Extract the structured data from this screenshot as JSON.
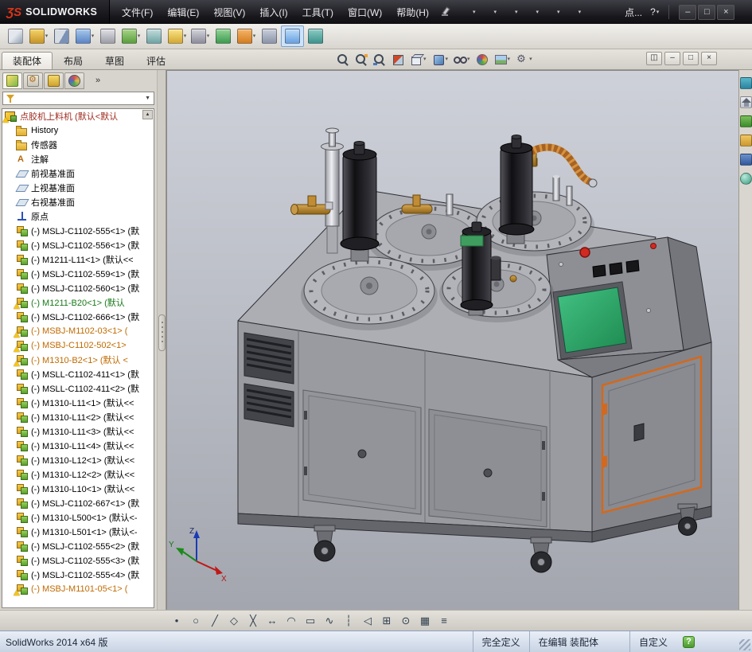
{
  "titlebar": {
    "brand_mark": "ƷS",
    "brand": "SOLIDWORKS",
    "menus": [
      {
        "label": "文件(F)"
      },
      {
        "label": "编辑(E)"
      },
      {
        "label": "视图(V)"
      },
      {
        "label": "插入(I)"
      },
      {
        "label": "工具(T)"
      },
      {
        "label": "窗口(W)"
      },
      {
        "label": "帮助(H)"
      }
    ],
    "quick_tools": [
      {
        "name": "new-document-icon",
        "cls": "q-new",
        "mods": "has-dd"
      },
      {
        "name": "open-icon",
        "cls": "q-open",
        "mods": "has-dd"
      },
      {
        "name": "save-icon",
        "cls": "q-save",
        "mods": "has-dd"
      },
      {
        "name": "print-icon",
        "cls": "q-print",
        "mods": "has-dd"
      },
      {
        "name": "undo-icon",
        "cls": "q-undo",
        "mods": "has-dd"
      },
      {
        "name": "select-icon",
        "cls": "q-select",
        "mods": "has-dd"
      },
      {
        "name": "rebuild-icon",
        "cls": "q-rebuild",
        "mods": ""
      },
      {
        "name": "options-gear-icon",
        "cls": "q-gear",
        "mods": ""
      }
    ],
    "more_label": "点...",
    "help_label": "?",
    "window_controls": [
      {
        "name": "minimize-button",
        "g": "–"
      },
      {
        "name": "maximize-button",
        "g": "□"
      },
      {
        "name": "close-button",
        "g": "×"
      }
    ]
  },
  "toolbar": {
    "buttons": [
      {
        "name": "edit-component-icon",
        "cls": "c1",
        "mods": ""
      },
      {
        "name": "insert-components-icon",
        "cls": "c2",
        "mods": "has-dd"
      },
      {
        "name": "mate-icon",
        "cls": "c3",
        "mods": ""
      },
      {
        "name": "linear-component-pattern-icon",
        "cls": "c4",
        "mods": "has-dd"
      },
      {
        "name": "smart-fasteners-icon",
        "cls": "c5",
        "mods": ""
      },
      {
        "name": "move-component-icon",
        "cls": "c6",
        "mods": "has-dd"
      },
      {
        "name": "show-hidden-components-icon",
        "cls": "c7",
        "mods": ""
      },
      {
        "name": "assembly-features-icon",
        "cls": "c8",
        "mods": "has-dd"
      },
      {
        "name": "reference-geometry-icon",
        "cls": "c9",
        "mods": "has-dd"
      },
      {
        "name": "new-motion-study-icon",
        "cls": "c10",
        "mods": ""
      },
      {
        "name": "bill-of-materials-icon",
        "cls": "c11",
        "mods": "has-dd"
      },
      {
        "name": "exploded-view-icon",
        "cls": "c12",
        "mods": ""
      },
      {
        "name": "instant3d-icon",
        "cls": "c13",
        "mods": "active"
      },
      {
        "name": "external-references-icon",
        "cls": "c14",
        "mods": ""
      }
    ]
  },
  "ribbon_tabs": [
    {
      "label": "装配体",
      "mods": "active"
    },
    {
      "label": "布局",
      "mods": ""
    },
    {
      "label": "草图",
      "mods": ""
    },
    {
      "label": "评估",
      "mods": ""
    }
  ],
  "headsup": [
    {
      "name": "zoom-fit-icon",
      "cls": "h-mag",
      "mods": ""
    },
    {
      "name": "zoom-area-icon",
      "cls": "h-mag2",
      "mods": ""
    },
    {
      "name": "previous-view-icon",
      "cls": "h-mag3",
      "mods": ""
    },
    {
      "name": "section-view-icon",
      "cls": "h-sect",
      "mods": ""
    },
    {
      "name": "view-orientation-icon",
      "cls": "h-cube",
      "mods": "has-dd"
    },
    {
      "name": "display-style-icon",
      "cls": "h-disp",
      "mods": "has-dd"
    },
    {
      "name": "hide-show-items-icon",
      "cls": "h-eye",
      "mods": "has-dd"
    },
    {
      "name": "edit-appearance-icon",
      "cls": "h-ball",
      "mods": ""
    },
    {
      "name": "apply-scene-icon",
      "cls": "h-scene",
      "mods": "has-dd"
    },
    {
      "name": "view-settings-icon",
      "cls": "h-gear",
      "mods": "has-dd"
    }
  ],
  "doc_controls": [
    {
      "name": "tile-window-button",
      "g": "◫"
    },
    {
      "name": "minimize-doc-button",
      "g": "–"
    },
    {
      "name": "restore-doc-button",
      "g": "□"
    },
    {
      "name": "close-doc-button",
      "g": "×"
    }
  ],
  "panel": {
    "tabs": [
      {
        "name": "featuremanager-tab",
        "cls": "pt-p1",
        "mods": "active"
      },
      {
        "name": "propertymanager-tab",
        "cls": "pt-p2",
        "mods": ""
      },
      {
        "name": "configurationmanager-tab",
        "cls": "pt-p3",
        "mods": ""
      },
      {
        "name": "displaymanager-tab",
        "cls": "pt-p4",
        "mods": ""
      }
    ],
    "overflow_label": "»",
    "filter_caret": "▼"
  },
  "tree": {
    "scroll_up": "▲",
    "items": [
      {
        "cls": "lvl0 c-red",
        "icon": "i-root",
        "warn": "on",
        "label": "点胶机上料机 (默认<默认"
      },
      {
        "cls": "lvl1",
        "icon": "i-fold",
        "warn": "",
        "label": "History"
      },
      {
        "cls": "lvl1",
        "icon": "i-fold",
        "warn": "",
        "label": "传感器"
      },
      {
        "cls": "lvl1",
        "icon": "i-ann",
        "warn": "",
        "label": "注解"
      },
      {
        "cls": "lvl1",
        "icon": "i-plane",
        "warn": "",
        "label": "前视基准面"
      },
      {
        "cls": "lvl1",
        "icon": "i-plane",
        "warn": "",
        "label": "上视基准面"
      },
      {
        "cls": "lvl1",
        "icon": "i-plane",
        "warn": "",
        "label": "右视基准面"
      },
      {
        "cls": "lvl1",
        "icon": "i-origin",
        "warn": "",
        "label": "原点"
      },
      {
        "cls": "lvl1",
        "icon": "i-asm",
        "warn": "",
        "label": "(-) MSLJ-C1102-555<1> (默"
      },
      {
        "cls": "lvl1",
        "icon": "i-asm",
        "warn": "",
        "label": "(-) MSLJ-C1102-556<1> (默"
      },
      {
        "cls": "lvl1",
        "icon": "i-asm",
        "warn": "",
        "label": "(-) M1211-L11<1> (默认<<"
      },
      {
        "cls": "lvl1",
        "icon": "i-asm",
        "warn": "",
        "label": "(-) MSLJ-C1102-559<1> (默"
      },
      {
        "cls": "lvl1",
        "icon": "i-asm",
        "warn": "",
        "label": "(-) MSLJ-C1102-560<1> (默"
      },
      {
        "cls": "lvl1 c-green",
        "icon": "i-asm",
        "warn": "on",
        "label": "(-) M1211-B20<1> (默认"
      },
      {
        "cls": "lvl1",
        "icon": "i-asm",
        "warn": "",
        "label": "(-) MSLJ-C1102-666<1> (默"
      },
      {
        "cls": "lvl1 c-orange",
        "icon": "i-asm",
        "warn": "on",
        "label": "(-) MSBJ-M1102-03<1> ("
      },
      {
        "cls": "lvl1 c-orange",
        "icon": "i-asm",
        "warn": "on",
        "label": "(-) MSBJ-C1102-502<1>"
      },
      {
        "cls": "lvl1 c-orange",
        "icon": "i-asm",
        "warn": "on",
        "label": "(-) M1310-B2<1> (默认 <"
      },
      {
        "cls": "lvl1",
        "icon": "i-asm",
        "warn": "",
        "label": "(-) MSLL-C1102-411<1> (默"
      },
      {
        "cls": "lvl1",
        "icon": "i-asm",
        "warn": "",
        "label": "(-) MSLL-C1102-411<2> (默"
      },
      {
        "cls": "lvl1",
        "icon": "i-asm",
        "warn": "",
        "label": "(-) M1310-L11<1> (默认<<"
      },
      {
        "cls": "lvl1",
        "icon": "i-asm",
        "warn": "",
        "label": "(-) M1310-L11<2> (默认<<"
      },
      {
        "cls": "lvl1",
        "icon": "i-asm",
        "warn": "",
        "label": "(-) M1310-L11<3> (默认<<"
      },
      {
        "cls": "lvl1",
        "icon": "i-asm",
        "warn": "",
        "label": "(-) M1310-L11<4> (默认<<"
      },
      {
        "cls": "lvl1",
        "icon": "i-asm",
        "warn": "",
        "label": "(-) M1310-L12<1> (默认<<"
      },
      {
        "cls": "lvl1",
        "icon": "i-asm",
        "warn": "",
        "label": "(-) M1310-L12<2> (默认<<"
      },
      {
        "cls": "lvl1",
        "icon": "i-asm",
        "warn": "",
        "label": "(-) M1310-L10<1> (默认<<"
      },
      {
        "cls": "lvl1",
        "icon": "i-asm",
        "warn": "",
        "label": "(-) MSLJ-C1102-667<1> (默"
      },
      {
        "cls": "lvl1",
        "icon": "i-asm",
        "warn": "",
        "label": "(-) M1310-L500<1> (默认<-"
      },
      {
        "cls": "lvl1",
        "icon": "i-asm",
        "warn": "",
        "label": "(-) M1310-L501<1> (默认<-"
      },
      {
        "cls": "lvl1",
        "icon": "i-asm",
        "warn": "",
        "label": "(-) MSLJ-C1102-555<2> (默"
      },
      {
        "cls": "lvl1",
        "icon": "i-asm",
        "warn": "",
        "label": "(-) MSLJ-C1102-555<3> (默"
      },
      {
        "cls": "lvl1",
        "icon": "i-asm",
        "warn": "",
        "label": "(-) MSLJ-C1102-555<4> (默"
      },
      {
        "cls": "lvl1 c-orange",
        "icon": "i-asm",
        "warn": "on",
        "label": "(-) MSBJ-M1101-05<1> ("
      }
    ]
  },
  "taskpane": [
    {
      "name": "solidworks-resources-icon",
      "cls": "tp1"
    },
    {
      "name": "home-icon",
      "cls": "tp2"
    },
    {
      "name": "design-library-icon",
      "cls": "tp3"
    },
    {
      "name": "file-explorer-icon",
      "cls": "tp4"
    },
    {
      "name": "view-palette-icon",
      "cls": "tp5"
    },
    {
      "name": "appearances-icon",
      "cls": "tp6"
    }
  ],
  "sketchbar": [
    {
      "name": "sketch-point-icon",
      "g": "•"
    },
    {
      "name": "sketch-circle-icon",
      "g": "○"
    },
    {
      "name": "sketch-line-icon",
      "g": "╱"
    },
    {
      "name": "sketch-polygon-icon",
      "g": "◇"
    },
    {
      "name": "trim-entities-icon",
      "g": "╳"
    },
    {
      "name": "smart-dimension-icon",
      "g": "↔"
    },
    {
      "name": "sketch-arc-icon",
      "g": "◠"
    },
    {
      "name": "sketch-rectangle-icon",
      "g": "▭"
    },
    {
      "name": "sketch-spline-icon",
      "g": "∿"
    },
    {
      "name": "centerline-icon",
      "g": "┆"
    },
    {
      "name": "mirror-entities-icon",
      "g": "◁"
    },
    {
      "name": "linear-sketch-pattern-icon",
      "g": "⊞"
    },
    {
      "name": "convert-entities-icon",
      "g": "⊙"
    },
    {
      "name": "sketch-grid-icon",
      "g": "▦"
    },
    {
      "name": "sketch-settings-icon",
      "g": "≡"
    }
  ],
  "statusbar": {
    "app_version": "SolidWorks 2014 x64 版",
    "define_state": "完全定义",
    "edit_state": "在编辑 装配体",
    "custom_label": "自定义",
    "help_glyph": "?"
  },
  "triad": {
    "x": "X",
    "y": "Y",
    "z": "Z"
  }
}
